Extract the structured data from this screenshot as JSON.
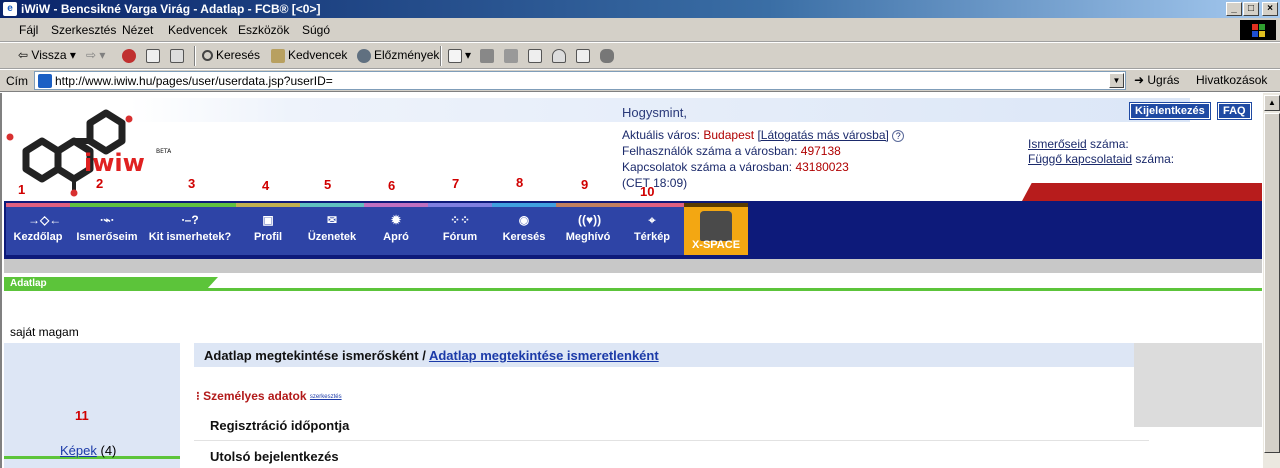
{
  "window": {
    "title": "iWiW - Bencsikné Varga Virág - Adatlap - FCB® [<0>]",
    "app_icon": "ie-icon",
    "buttons": [
      "minimize",
      "maximize",
      "close"
    ]
  },
  "menubar": {
    "items": [
      "Fájl",
      "Szerkesztés",
      "Nézet",
      "Kedvencek",
      "Eszközök",
      "Súgó"
    ]
  },
  "toolbar": {
    "back": "Vissza",
    "search": "Keresés",
    "favorites": "Kedvencek",
    "history": "Előzmények"
  },
  "address": {
    "label": "Cím",
    "url": "http://www.iwiw.hu/pages/user/userdata.jsp?userID=",
    "go": "Ugrás",
    "links": "Hivatkozások"
  },
  "header": {
    "greeting": "Hogysmint,",
    "city_label": "Aktuális város:",
    "city_value": "Budapest",
    "city_link": "[Látogatás más városba]",
    "users_label": "Felhasználók száma a városban:",
    "users_value": "497138",
    "connections_label": "Kapcsolatok száma a városban:",
    "connections_value": "43180023",
    "time": "(CET 18:09)",
    "logout": "Kijelentkezés",
    "faq": "FAQ",
    "friends_link": "Ismerőseid",
    "friends_suffix": " száma:",
    "pending_link": "Függő kapcsolataid",
    "pending_suffix": " száma:",
    "logo_text": "iwiw",
    "logo_beta": "BETA"
  },
  "nav": {
    "tabs": [
      {
        "label": "Kezdőlap",
        "number": "1",
        "color": "#e06080"
      },
      {
        "label": "Ismerőseim",
        "number": "2",
        "color": "#60c040"
      },
      {
        "label": "Kit ismerhetek?",
        "number": "3",
        "color": "#60c040"
      },
      {
        "label": "Profil",
        "number": "4",
        "color": "#c0b050"
      },
      {
        "label": "Üzenetek",
        "number": "5",
        "color": "#60c0c0"
      },
      {
        "label": "Apró",
        "number": "6",
        "color": "#c070c0"
      },
      {
        "label": "Fórum",
        "number": "7",
        "color": "#8080e0"
      },
      {
        "label": "Keresés",
        "number": "8",
        "color": "#40a0e0"
      },
      {
        "label": "Meghívó",
        "number": "9",
        "color": "#c08060"
      },
      {
        "label": "Térkép",
        "number": "10",
        "color": "#e06080"
      }
    ],
    "xspace": "X-SPACE"
  },
  "breadcrumb": "Adatlap",
  "left": {
    "self": "saját magam",
    "number": "11",
    "pictures_link": "Képek",
    "pictures_count": "(4)"
  },
  "main": {
    "view_current": "Adatlap megtekintése ismerősként",
    "view_separator": " / ",
    "view_other": "Adatlap megtekintése ismeretlenként",
    "section_title": "Személyes adatok",
    "section_edit": "szerkesztés",
    "rows": [
      "Regisztráció időpontja",
      "Utolsó bejelentkezés"
    ]
  }
}
